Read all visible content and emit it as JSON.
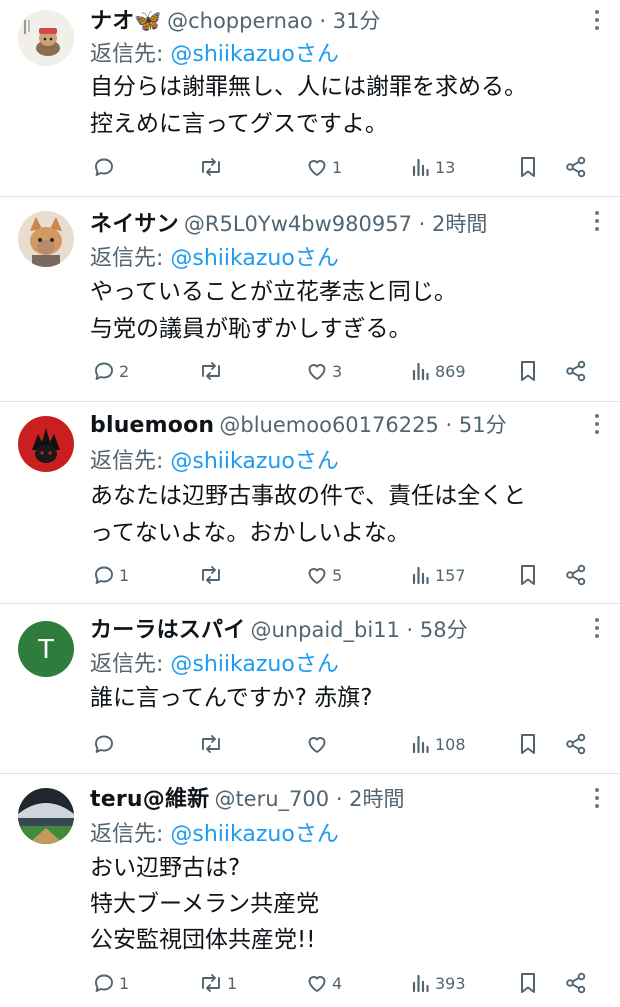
{
  "tweets": [
    {
      "name": "ナオ🦋",
      "handle": "@choppernao",
      "time": "31分",
      "reply_prefix": "返信先: ",
      "reply_to": "@shiikazuoさん",
      "lines": [
        "自分らは謝罪無し、人には謝罪を求める。",
        "控えめに言ってグスですよ。"
      ],
      "replies": "",
      "retweets": "",
      "likes": "1",
      "views": "13",
      "avatar_icon": "chopper-illustration-avatar"
    },
    {
      "name": "ネイサン",
      "handle": "@R5L0Yw4bw980957",
      "time": "2時間",
      "reply_prefix": "返信先: ",
      "reply_to": "@shiikazuoさん",
      "lines": [
        "やっていることが立花孝志と同じ。",
        "与党の議員が恥ずかしすぎる。"
      ],
      "replies": "2",
      "retweets": "",
      "likes": "3",
      "views": "869",
      "avatar_icon": "cat-photo-avatar"
    },
    {
      "name": "bluemoon",
      "handle": "@bluemoo60176225",
      "time": "51分",
      "reply_prefix": "返信先: ",
      "reply_to": "@shiikazuoさん",
      "lines": [
        "あなたは辺野古事故の件で、責任は全くと",
        "ってないよな。おかしいよな。"
      ],
      "replies": "1",
      "retweets": "",
      "likes": "5",
      "views": "157",
      "avatar_icon": "red-circle-character-avatar"
    },
    {
      "name": "カーラはスパイ",
      "handle": "@unpaid_bi11",
      "time": "58分",
      "reply_prefix": "返信先: ",
      "reply_to": "@shiikazuoさん",
      "lines": [
        "誰に言ってんですか? 赤旗?"
      ],
      "replies": "",
      "retweets": "",
      "likes": "",
      "views": "108",
      "avatar_letter": "T",
      "avatar_color": "#2f7d3c"
    },
    {
      "name": "teru@維新",
      "handle": "@teru_700",
      "time": "2時間",
      "reply_prefix": "返信先: ",
      "reply_to": "@shiikazuoさん",
      "lines": [
        "おい辺野古は?",
        "特大ブーメラン共産党",
        "公安監視団体共産党!!"
      ],
      "replies": "1",
      "retweets": "1",
      "likes": "4",
      "views": "393",
      "avatar_icon": "stadium-photo-avatar"
    }
  ],
  "separator": " · ",
  "icons": {
    "reply": "reply-icon",
    "retweet": "retweet-icon",
    "like": "like-icon",
    "views": "views-icon",
    "bookmark": "bookmark-icon",
    "share": "share-icon",
    "more": "more-icon"
  },
  "colors": {
    "link": "#1d9bf0",
    "muted": "#536471",
    "text": "#0f1419",
    "divider": "#dfe3e7"
  }
}
